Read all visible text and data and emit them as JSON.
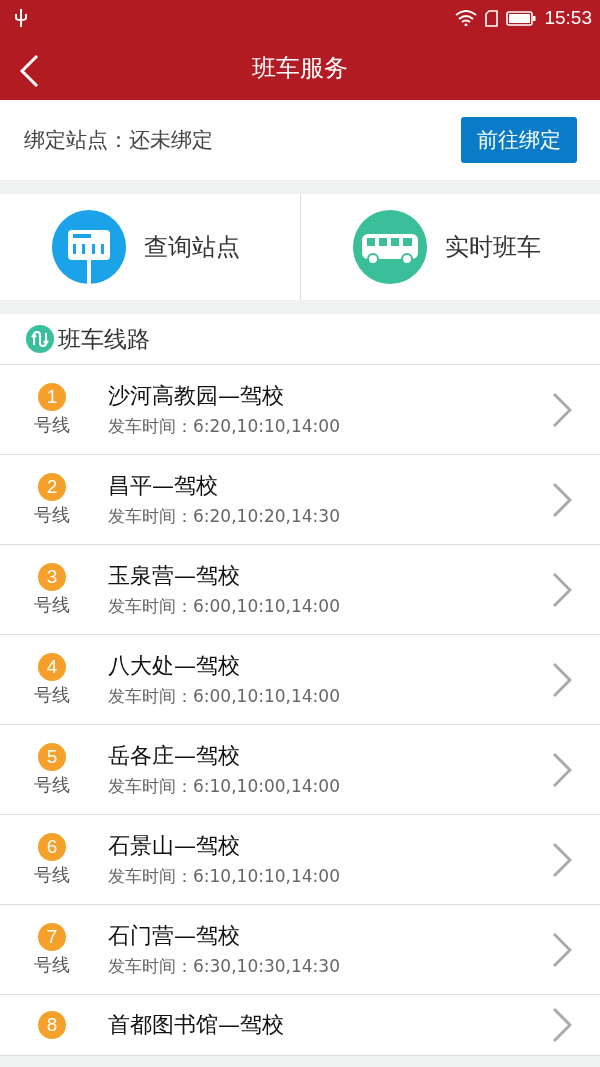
{
  "status_bar": {
    "time": "15:53"
  },
  "header": {
    "title": "班车服务"
  },
  "binding": {
    "label": "绑定站点：还未绑定",
    "button": "前往绑定"
  },
  "shortcuts": [
    {
      "kind": "stop",
      "label": "查询站点"
    },
    {
      "kind": "bus",
      "label": "实时班车"
    }
  ],
  "routes_section": {
    "title": "班车线路"
  },
  "routes": [
    {
      "number": "1",
      "line_label": "号线",
      "name": "沙河高教园—驾校",
      "times": "发车时间：6:20,10:10,14:00"
    },
    {
      "number": "2",
      "line_label": "号线",
      "name": "昌平—驾校",
      "times": "发车时间：6:20,10:20,14:30"
    },
    {
      "number": "3",
      "line_label": "号线",
      "name": "玉泉营—驾校",
      "times": "发车时间：6:00,10:10,14:00"
    },
    {
      "number": "4",
      "line_label": "号线",
      "name": "八大处—驾校",
      "times": "发车时间：6:00,10:10,14:00"
    },
    {
      "number": "5",
      "line_label": "号线",
      "name": "岳各庄—驾校",
      "times": "发车时间：6:10,10:00,14:00"
    },
    {
      "number": "6",
      "line_label": "号线",
      "name": "石景山—驾校",
      "times": "发车时间：6:10,10:10,14:00"
    },
    {
      "number": "7",
      "line_label": "号线",
      "name": "石门营—驾校",
      "times": "发车时间：6:30,10:30,14:30"
    },
    {
      "number": "8",
      "name": "首都图书馆—驾校"
    }
  ]
}
